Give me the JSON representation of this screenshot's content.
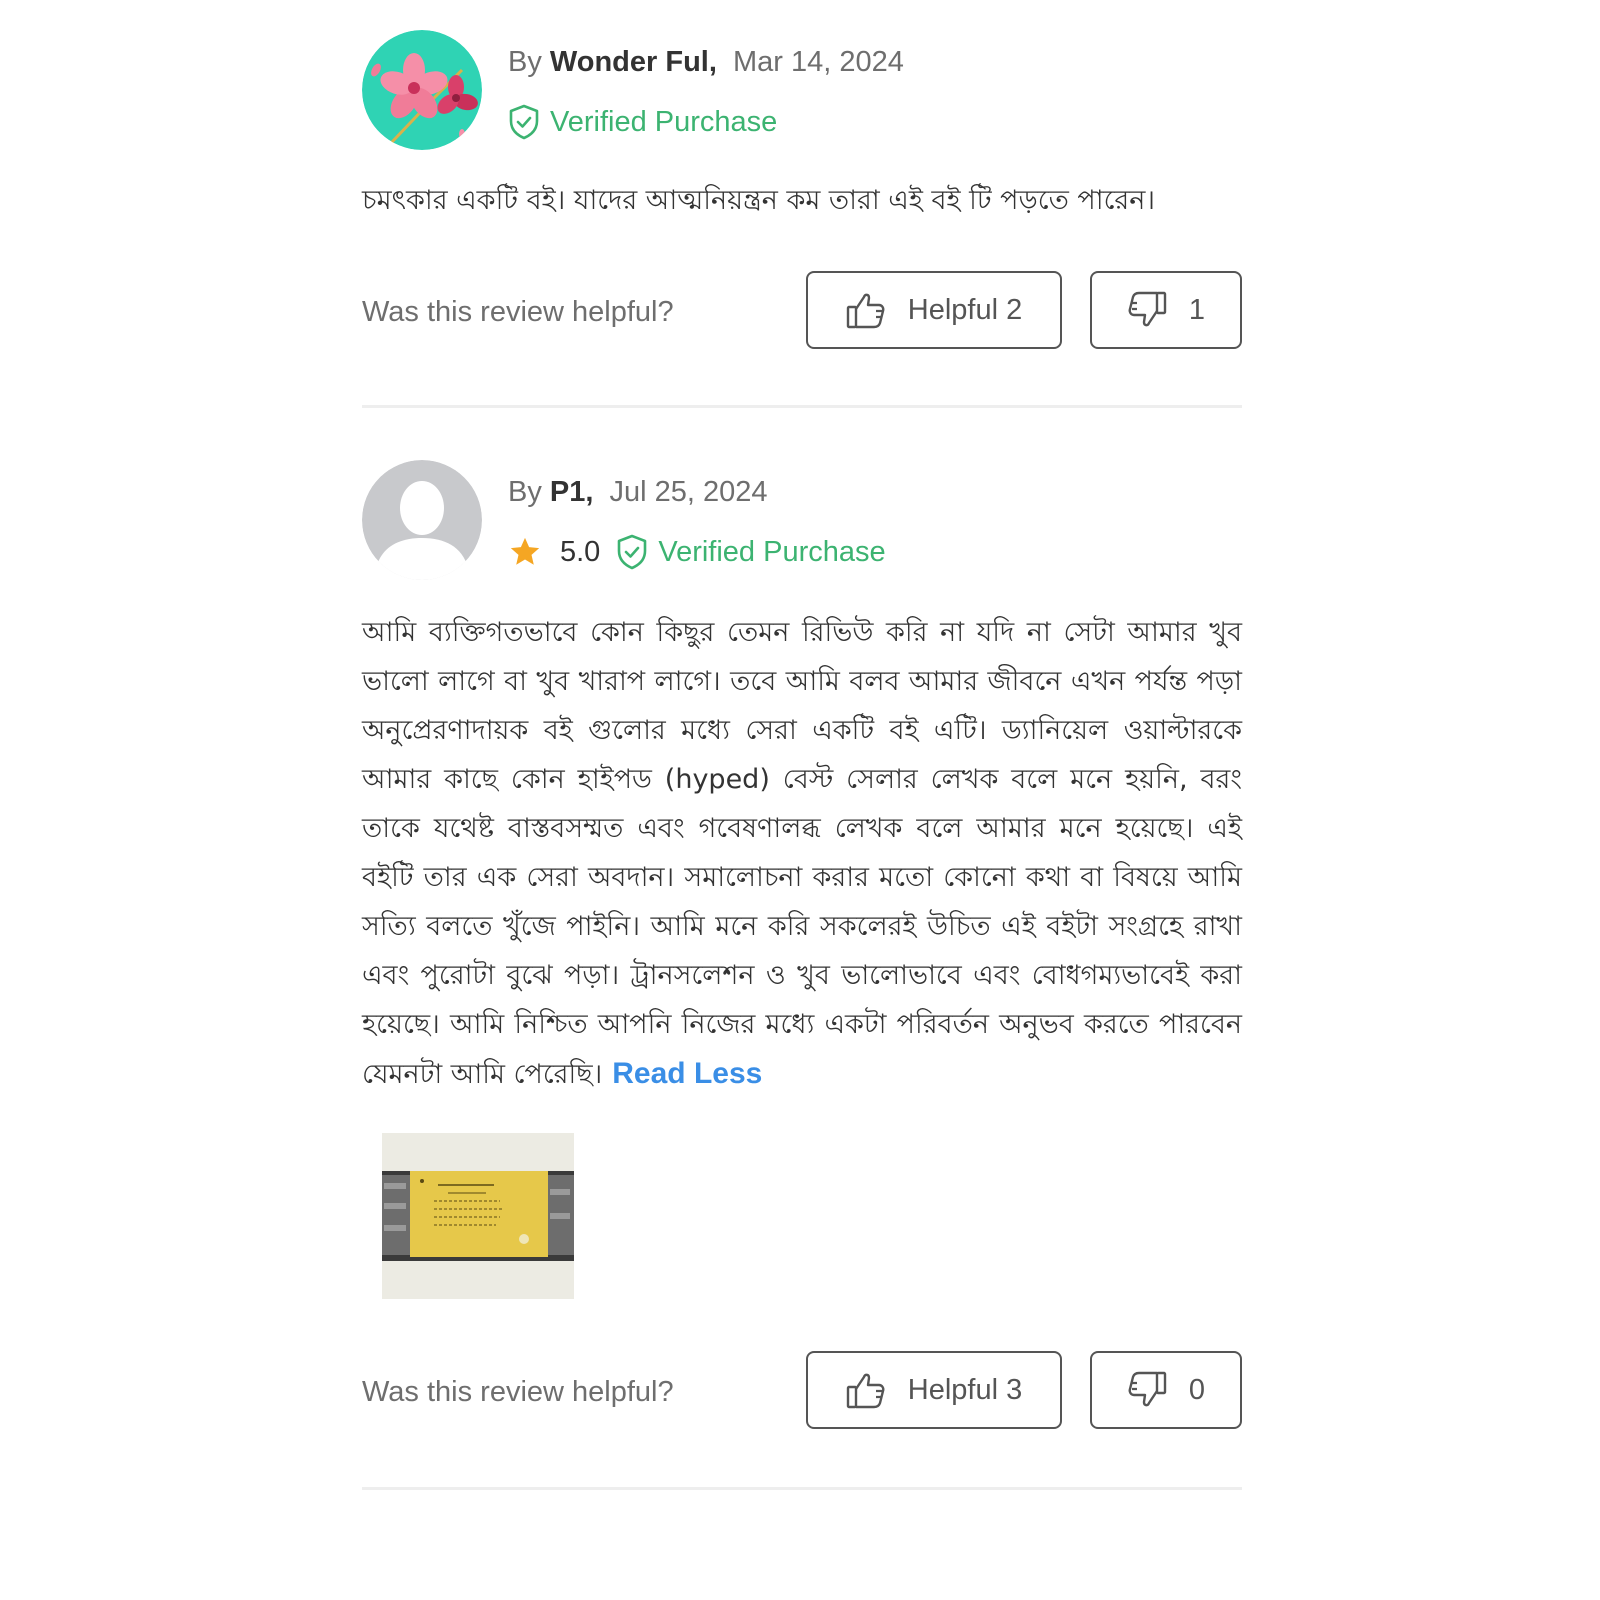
{
  "colors": {
    "verified_green": "#3cb371",
    "link_blue": "#3a8ee6",
    "star_orange": "#f5a623",
    "text_dark": "#333333",
    "text_muted": "#6e6e6e",
    "divider": "#eeeeee"
  },
  "reviews": [
    {
      "by_label": "By",
      "author": "Wonder Ful,",
      "date": "Mar 14, 2024",
      "avatar_icon": "flower-avatar-icon",
      "verified_label": "Verified Purchase",
      "text": "চমৎকার একটি বই। যাদের আত্মনিয়ন্ত্রন কম তারা এই বই টি পড়তে পারেন।",
      "helpful_question": "Was this review helpful?",
      "helpful_label": "Helpful 2",
      "unhelpful_count": "1"
    },
    {
      "by_label": "By",
      "author": "P1,",
      "date": "Jul 25, 2024",
      "avatar_icon": "default-user-avatar-icon",
      "rating": "5.0",
      "verified_label": "Verified Purchase",
      "text": "আমি ব্যক্তিগতভাবে কোন কিছুর তেমন রিভিউ করি না যদি না সেটা আমার খুব ভালো লাগে বা খুব খারাপ লাগে। তবে আমি বলব আমার জীবনে এখন পর্যন্ত পড়া অনুপ্রেরণাদায়ক বই গুলোর মধ্যে সেরা একটি বই এটি। ড্যানিয়েল ওয়াল্টারকে আমার কাছে কোন হাইপড (hyped) বেস্ট সেলার লেখক বলে মনে হয়নি, বরং তাকে যথেষ্ট বাস্তবসম্মত এবং গবেষণালব্ধ লেখক বলে আমার মনে হয়েছে। এই বইটি তার এক সেরা অবদান। সমালোচনা করার মতো কোনো কথা বা বিষয়ে আমি সত্যি বলতে খুঁজে পাইনি। আমি মনে করি সকলেরই উচিত এই বইটা সংগ্রহে রাখা এবং পুরোটা বুঝে পড়া। ট্রানসলেশন ও খুব ভালোভাবে এবং বোধগম্যভাবেই করা হয়েছে। আমি নিশ্চিত আপনি নিজের মধ্যে একটা পরিবর্তন অনুভব করতে পারবেন যেমনটা আমি পেরেছি।",
      "read_less_label": "Read Less",
      "helpful_question": "Was this review helpful?",
      "helpful_label": "Helpful 3",
      "unhelpful_count": "0"
    }
  ]
}
